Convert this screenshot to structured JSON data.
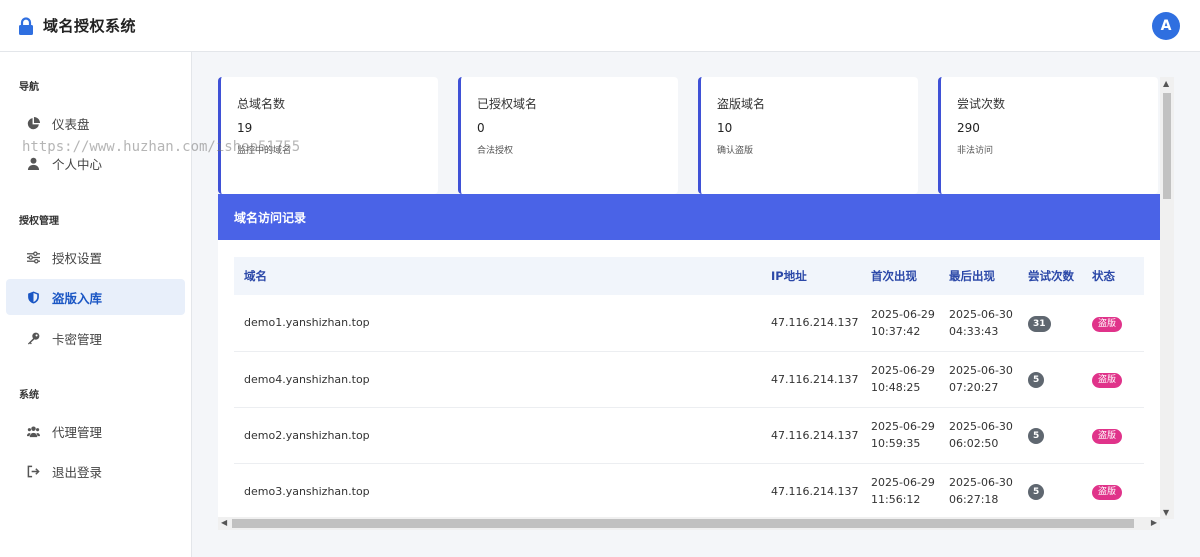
{
  "header": {
    "title": "域名授权系统",
    "avatar_letter": "A"
  },
  "sidebar": {
    "sections": [
      {
        "title": "导航"
      },
      {
        "title": "授权管理"
      },
      {
        "title": "系统"
      }
    ],
    "items": [
      {
        "label": "仪表盘",
        "icon": "pie-chart-icon"
      },
      {
        "label": "个人中心",
        "icon": "user-icon"
      },
      {
        "label": "授权设置",
        "icon": "sliders-icon"
      },
      {
        "label": "盗版入库",
        "icon": "shield-icon",
        "active": true
      },
      {
        "label": "卡密管理",
        "icon": "key-icon"
      },
      {
        "label": "代理管理",
        "icon": "users-icon"
      },
      {
        "label": "退出登录",
        "icon": "logout-icon"
      }
    ]
  },
  "watermark": "https://www.huzhan.com/ishop51755",
  "stats": [
    {
      "label": "总域名数",
      "value": "19",
      "note": "监控中的域名"
    },
    {
      "label": "已授权域名",
      "value": "0",
      "note": "合法授权"
    },
    {
      "label": "盗版域名",
      "value": "10",
      "note": "确认盗版"
    },
    {
      "label": "尝试次数",
      "value": "290",
      "note": "非法访问"
    }
  ],
  "log": {
    "title": "域名访问记录",
    "columns": [
      "域名",
      "IP地址",
      "首次出现",
      "最后出现",
      "尝试次数",
      "状态"
    ],
    "rows": [
      {
        "domain": "demo1.yanshizhan.top",
        "ip": "47.116.214.137",
        "first_date": "2025-06-29",
        "first_time": "10:37:42",
        "last_date": "2025-06-30",
        "last_time": "04:33:43",
        "count": "31",
        "status": "盗版"
      },
      {
        "domain": "demo4.yanshizhan.top",
        "ip": "47.116.214.137",
        "first_date": "2025-06-29",
        "first_time": "10:48:25",
        "last_date": "2025-06-30",
        "last_time": "07:20:27",
        "count": "5",
        "status": "盗版"
      },
      {
        "domain": "demo2.yanshizhan.top",
        "ip": "47.116.214.137",
        "first_date": "2025-06-29",
        "first_time": "10:59:35",
        "last_date": "2025-06-30",
        "last_time": "06:02:50",
        "count": "5",
        "status": "盗版"
      },
      {
        "domain": "demo3.yanshizhan.top",
        "ip": "47.116.214.137",
        "first_date": "2025-06-29",
        "first_time": "11:56:12",
        "last_date": "2025-06-30",
        "last_time": "06:27:18",
        "count": "5",
        "status": "盗版"
      }
    ]
  },
  "colors": {
    "accent": "#4a63e7",
    "brand_blue": "#2f6fe0",
    "badge_pink": "#e0338a",
    "badge_gray": "#5f6770"
  }
}
